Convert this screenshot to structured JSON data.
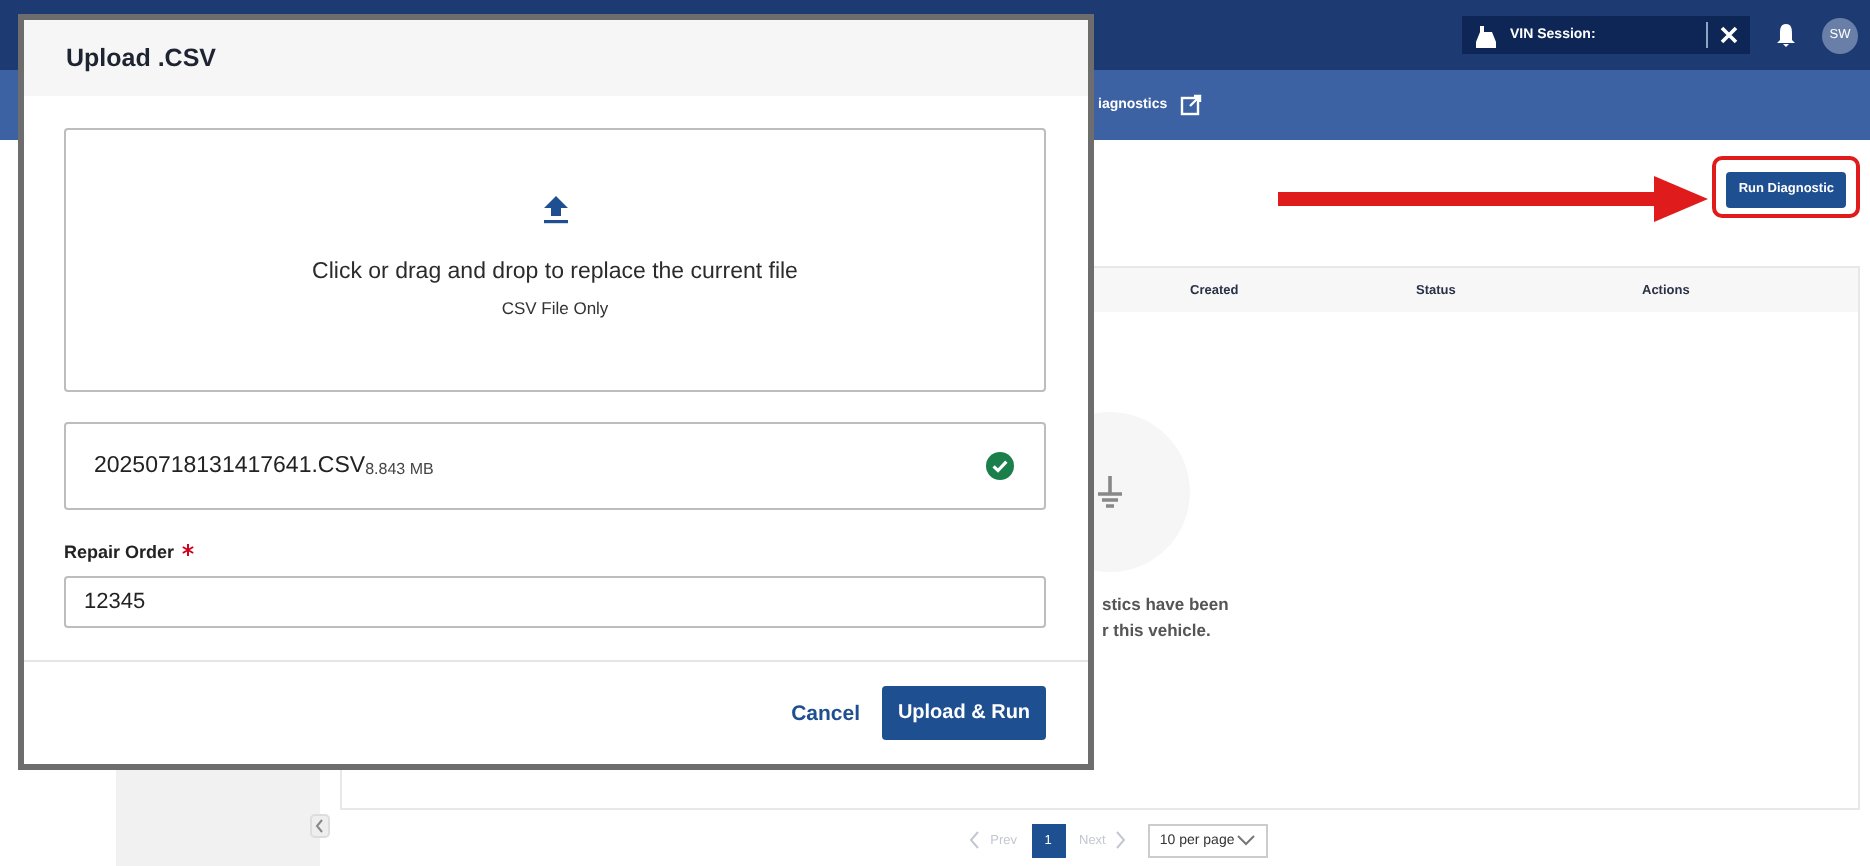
{
  "top_bar": {
    "vin_session": {
      "label": "VIN Session:"
    },
    "avatar": "SW"
  },
  "sub_nav": {
    "link": "iagnostics"
  },
  "toolbar": {
    "run_button": {
      "label": "Run Diagnostic",
      "highlighted": true
    }
  },
  "table": {
    "columns": [
      "Created",
      "Status",
      "Actions"
    ],
    "empty_message": [
      "stics have been",
      "r this vehicle."
    ]
  },
  "pagination": {
    "prev": {
      "label": "Prev",
      "disabled": true
    },
    "pages": [
      {
        "label": "1",
        "selected": true
      }
    ],
    "next": {
      "label": "Next",
      "disabled": true
    },
    "page_size": "10 per page"
  },
  "dialog": {
    "title": "Upload .CSV",
    "dropzone": {
      "text": "Click or drag and drop to replace the current file",
      "hint": "CSV File Only"
    },
    "file": {
      "name": "20250718131417641.CSV",
      "size": "8.843 MB",
      "verified": true
    },
    "repair_order": {
      "label": "Repair Order",
      "required": true,
      "value": "12345"
    },
    "buttons": [
      {
        "label": "Cancel",
        "kind": "text"
      },
      {
        "label": "Upload & Run",
        "kind": "primary"
      }
    ]
  }
}
